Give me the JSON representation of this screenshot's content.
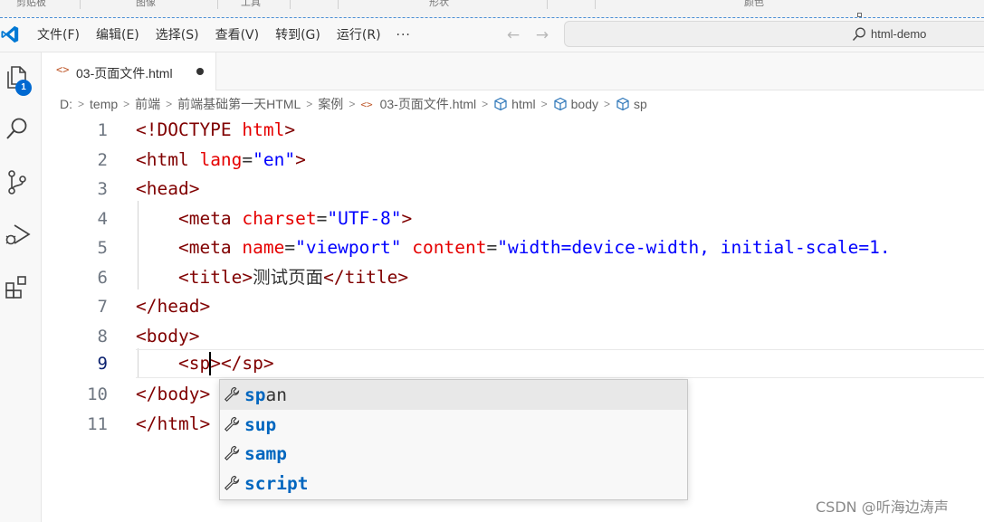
{
  "ribbon": {
    "labels": [
      "剪贴板",
      "图像",
      "工具",
      "形状",
      "颜色"
    ]
  },
  "menu": {
    "items": [
      "文件(F)",
      "编辑(E)",
      "选择(S)",
      "查看(V)",
      "转到(G)",
      "运行(R)"
    ],
    "more": "···"
  },
  "nav": {
    "back": "←",
    "forward": "→"
  },
  "command_center": {
    "text": "html-demo"
  },
  "activity": {
    "explorer_badge": "1"
  },
  "tab": {
    "icon": "<>",
    "label": "03-页面文件.html"
  },
  "breadcrumb": {
    "items": [
      "D:",
      "temp",
      "前端",
      "前端基础第一天HTML",
      "案例",
      "03-页面文件.html",
      "html",
      "body",
      "sp"
    ]
  },
  "editor": {
    "line_numbers": [
      "1",
      "2",
      "3",
      "4",
      "5",
      "6",
      "7",
      "8",
      "9",
      "10",
      "11"
    ],
    "current_line": 9,
    "title_text": "测试页面"
  },
  "suggest": {
    "items": [
      {
        "match": "sp",
        "rest": "an"
      },
      {
        "match": "s",
        "mid": "u",
        "match2": "p",
        "rest": ""
      },
      {
        "match": "s",
        "mid": "am",
        "match2": "p",
        "rest": ""
      },
      {
        "match": "s",
        "mid": "cri",
        "match2": "p",
        "rest": "t"
      }
    ],
    "labels": [
      "span",
      "sup",
      "samp",
      "script"
    ]
  },
  "watermark": "CSDN @听海边涛声",
  "colors": {
    "tag": "#800000",
    "attribute": "#e50000",
    "string": "#0000ff",
    "match_highlight": "#0066bf",
    "badge": "#0069d1",
    "logo": "#0078d4"
  }
}
